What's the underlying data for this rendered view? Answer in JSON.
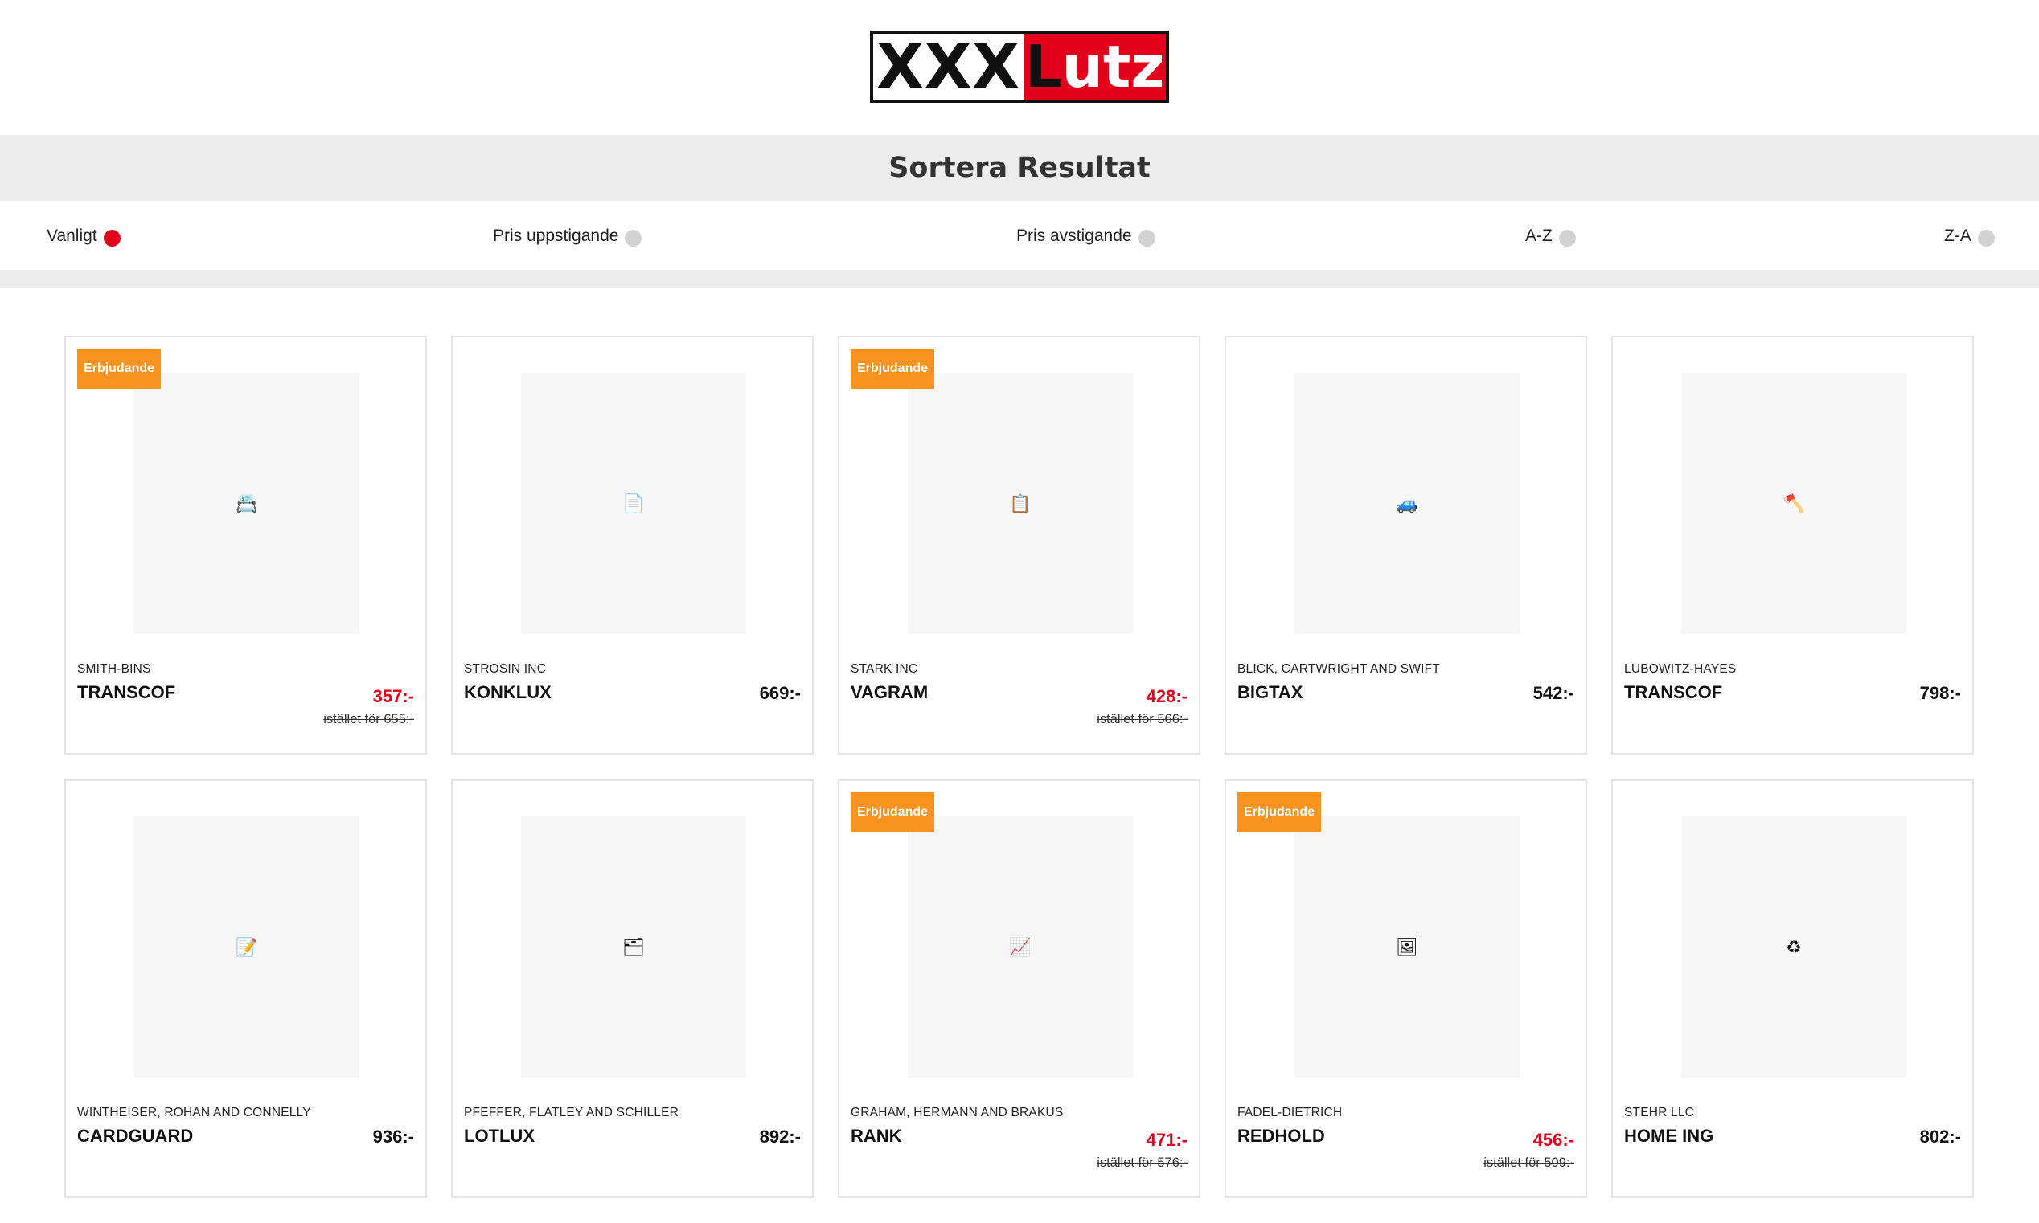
{
  "logo": {
    "text_a": "XXX",
    "text_b_first": "L",
    "text_b_rest": "utz",
    "colors": {
      "red": "#e2001a",
      "black": "#111111"
    }
  },
  "sort": {
    "title": "Sortera Resultat",
    "options": [
      {
        "label": "Vanligt",
        "active": true
      },
      {
        "label": "Pris uppstigande",
        "active": false
      },
      {
        "label": "Pris avstigande",
        "active": false
      },
      {
        "label": "A-Z",
        "active": false
      },
      {
        "label": "Z-A",
        "active": false
      }
    ]
  },
  "products": [
    {
      "badge": "Erbjudande",
      "icon": "📇",
      "icon_name": "card-index-icon",
      "brand": "SMITH-BINS",
      "name": "TRANSCOF",
      "price": "357:-",
      "old_price": "istället för 655:-"
    },
    {
      "badge": "",
      "icon": "📄",
      "icon_name": "document-icon",
      "brand": "STROSIN INC",
      "name": "KONKLUX",
      "price": "669:-",
      "old_price": ""
    },
    {
      "badge": "Erbjudande",
      "icon": "📋",
      "icon_name": "list-icon",
      "brand": "STARK INC",
      "name": "VAGRAM",
      "price": "428:-",
      "old_price": "istället för 566:-"
    },
    {
      "badge": "",
      "icon": "🚙",
      "icon_name": "car-icon",
      "brand": "BLICK, CARTWRIGHT AND SWIFT",
      "name": "BIGTAX",
      "price": "542:-",
      "old_price": ""
    },
    {
      "badge": "",
      "icon": "🪓",
      "icon_name": "axe-icon",
      "brand": "LUBOWITZ-HAYES",
      "name": "TRANSCOF",
      "price": "798:-",
      "old_price": ""
    },
    {
      "badge": "",
      "icon": "📝",
      "icon_name": "note-icon",
      "brand": "WINTHEISER, ROHAN AND CONNELLY",
      "name": "CARDGUARD",
      "price": "936:-",
      "old_price": ""
    },
    {
      "badge": "",
      "icon": "🗂",
      "icon_name": "folder-icon",
      "brand": "PFEFFER, FLATLEY AND SCHILLER",
      "name": "LOTLUX",
      "price": "892:-",
      "old_price": ""
    },
    {
      "badge": "Erbjudande",
      "icon": "📈",
      "icon_name": "chart-icon",
      "brand": "GRAHAM, HERMANN AND BRAKUS",
      "name": "RANK",
      "price": "471:-",
      "old_price": "istället för 576:-"
    },
    {
      "badge": "Erbjudande",
      "icon": "🖼",
      "icon_name": "picture-icon",
      "brand": "FADEL-DIETRICH",
      "name": "REDHOLD",
      "price": "456:-",
      "old_price": "istället för 509:-"
    },
    {
      "badge": "",
      "icon": "♻",
      "icon_name": "recycle-icon",
      "brand": "STEHR LLC",
      "name": "HOME ING",
      "price": "802:-",
      "old_price": ""
    }
  ]
}
